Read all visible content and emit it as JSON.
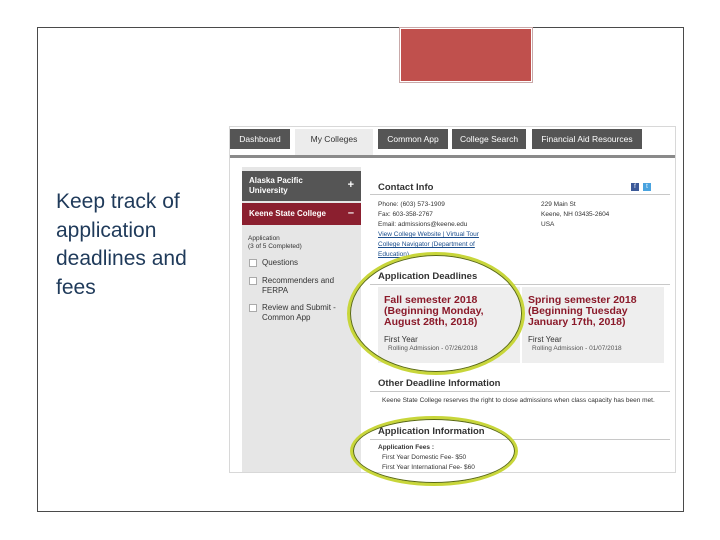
{
  "slide": {
    "text": "Keep track of application deadlines and fees",
    "accent_color": "#c0504d"
  },
  "nav": {
    "tabs": [
      {
        "label": "Dashboard"
      },
      {
        "label": "My Colleges"
      },
      {
        "label": "Common App"
      },
      {
        "label": "College Search"
      },
      {
        "label": "Financial Aid Resources"
      }
    ]
  },
  "sidebar": {
    "colleges": [
      {
        "label": "Alaska Pacific University",
        "toggle": "+"
      },
      {
        "label": "Keene State College",
        "toggle": "–"
      }
    ],
    "application_heading": "Application",
    "application_progress": "(3 of 5 Completed)",
    "items": [
      {
        "label": "Questions"
      },
      {
        "label": "Recommenders and FERPA"
      },
      {
        "label": "Review and Submit - Common App"
      }
    ]
  },
  "contact": {
    "heading": "Contact Info",
    "phone": "Phone: (603) 573-1909",
    "fax": "Fax: 603-358-2767",
    "email": "Email: admissions@keene.edu",
    "links": "View College Website | Virtual Tour",
    "links2": "College Navigator (Department of",
    "links3": "Education)",
    "address1": "229 Main St",
    "address2": "Keene, NH 03435-2604",
    "address3": "USA",
    "social_icons": [
      "facebook-icon",
      "twitter-icon"
    ]
  },
  "deadlines": {
    "heading": "Application Deadlines",
    "terms": [
      {
        "title": "Fall semester 2018 (Beginning Monday, August 28th, 2018)",
        "type": "First Year",
        "rule": "Rolling Admission - 07/26/2018"
      },
      {
        "title": "Spring semester 2018 (Beginning Tuesday January 17th, 2018)",
        "type": "First Year",
        "rule": "Rolling Admission - 01/07/2018"
      }
    ]
  },
  "other": {
    "heading": "Other Deadline Information",
    "text": "Keene State College reserves the right to close admissions when class capacity has been met."
  },
  "app_info": {
    "heading": "Application Information",
    "fees_label": "Application Fees :",
    "fee1": "First Year Domestic Fee- $50",
    "fee2": "First Year International Fee- $60"
  },
  "highlight_color": "#c8d63a"
}
